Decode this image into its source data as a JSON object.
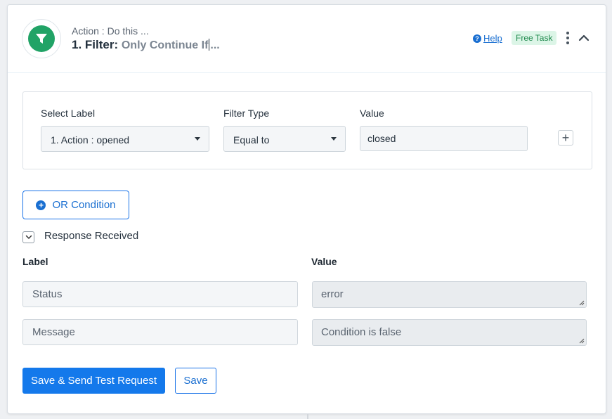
{
  "header": {
    "subtitle": "Action : Do this ...",
    "title_prefix": "1. Filter:",
    "title_desc_before": "Only Continue If",
    "title_desc_after": "...",
    "help_label": "Help",
    "help_icon": "?",
    "badge": "Free Task",
    "icon": "filter-icon"
  },
  "filter": {
    "select_label_heading": "Select Label",
    "select_label_value": "1. Action : opened",
    "filter_type_heading": "Filter Type",
    "filter_type_value": "Equal to",
    "value_heading": "Value",
    "value": "closed",
    "add_symbol": "+"
  },
  "or_condition": {
    "label": "OR Condition",
    "symbol": "+"
  },
  "response": {
    "title": "Response Received",
    "label_heading": "Label",
    "value_heading": "Value",
    "rows": [
      {
        "label": "Status",
        "value": "error"
      },
      {
        "label": "Message",
        "value": "Condition is false"
      }
    ]
  },
  "actions": {
    "save_test_label": "Save & Send Test Request",
    "save_label": "Save"
  },
  "colors": {
    "accent": "#1479eb",
    "success": "#21a366",
    "badge_bg": "#dcf5e7"
  }
}
